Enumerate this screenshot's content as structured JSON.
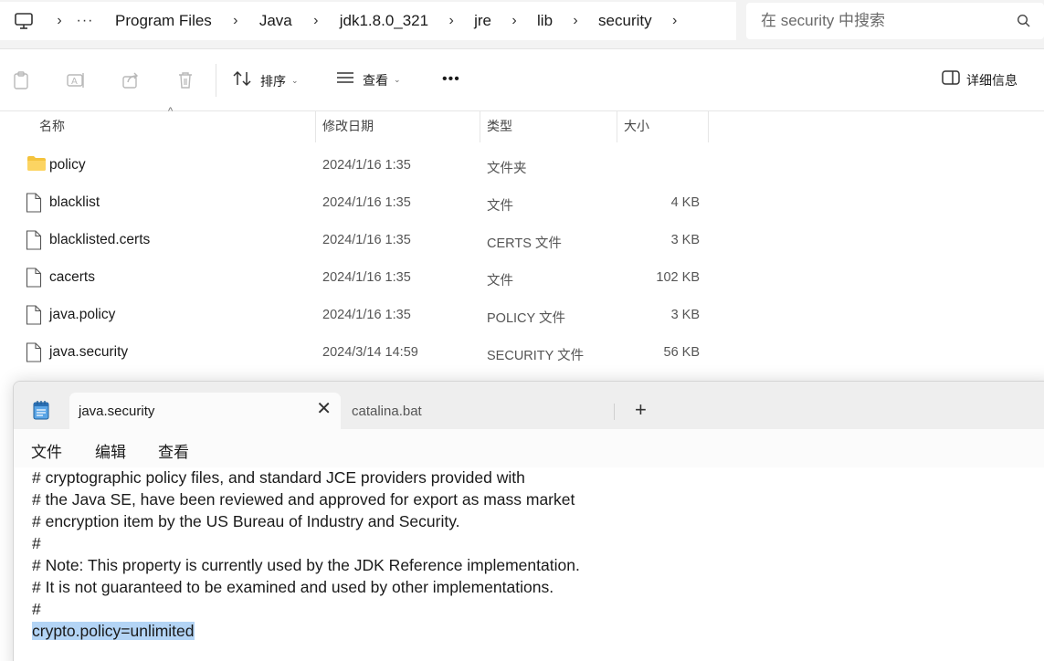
{
  "explorer": {
    "breadcrumb": [
      "Program Files",
      "Java",
      "jdk1.8.0_321",
      "jre",
      "lib",
      "security"
    ],
    "overflow_label": "···",
    "search": {
      "placeholder": "在 security 中搜索"
    },
    "toolbar": {
      "sort_label": "排序",
      "view_label": "查看",
      "more_label": "•••",
      "details_label": "详细信息"
    },
    "columns": {
      "name": "名称",
      "modified": "修改日期",
      "type": "类型",
      "size": "大小"
    },
    "files": [
      {
        "name": "policy",
        "modified": "2024/1/16 1:35",
        "type": "文件夹",
        "size": "",
        "icon": "folder-icon"
      },
      {
        "name": "blacklist",
        "modified": "2024/1/16 1:35",
        "type": "文件",
        "size": "4 KB",
        "icon": "file-icon"
      },
      {
        "name": "blacklisted.certs",
        "modified": "2024/1/16 1:35",
        "type": "CERTS 文件",
        "size": "3 KB",
        "icon": "file-icon"
      },
      {
        "name": "cacerts",
        "modified": "2024/1/16 1:35",
        "type": "文件",
        "size": "102 KB",
        "icon": "file-icon"
      },
      {
        "name": "java.policy",
        "modified": "2024/1/16 1:35",
        "type": "POLICY 文件",
        "size": "3 KB",
        "icon": "file-icon"
      },
      {
        "name": "java.security",
        "modified": "2024/3/14 14:59",
        "type": "SECURITY 文件",
        "size": "56 KB",
        "icon": "file-icon"
      }
    ]
  },
  "notepad": {
    "tabs": [
      {
        "label": "java.security",
        "active": true
      },
      {
        "label": "catalina.bat",
        "active": false
      }
    ],
    "menu": {
      "file": "文件",
      "edit": "编辑",
      "view": "查看"
    },
    "lines": [
      "# cryptographic policy files, and standard JCE providers provided with",
      "# the Java SE, have been reviewed and approved for export as mass market",
      "# encryption item by the US Bureau of Industry and Security.",
      "#",
      "# Note: This property is currently used by the JDK Reference implementation.",
      "# It is not guaranteed to be examined and used by other implementations.",
      "#",
      "crypto.policy=unlimited"
    ],
    "selected_line_index": 7,
    "selection_color": "#b3d4f5"
  },
  "colors": {
    "folder": "#f4c33d",
    "chrome": "#f3f3f3",
    "tabbar": "#eeeeee"
  }
}
